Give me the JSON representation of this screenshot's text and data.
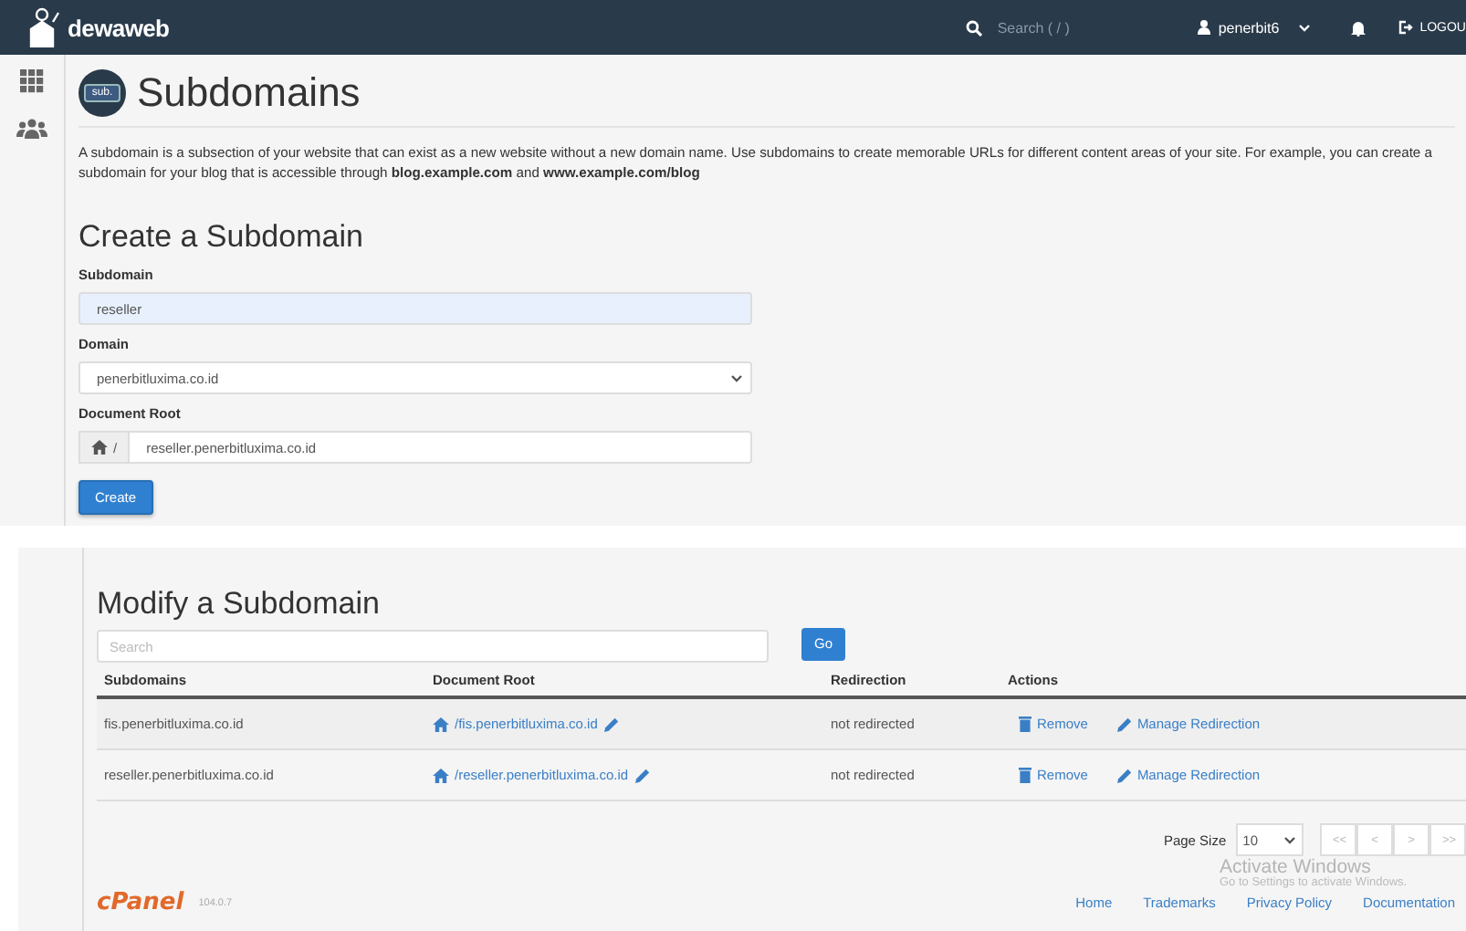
{
  "top_bar": {
    "brand": "dewaweb",
    "search": {
      "placeholder": "Search ( / )"
    },
    "user": "penerbit6",
    "logout": "LOGOU"
  },
  "page": {
    "title": "Subdomains",
    "icon_text": "sub.",
    "description": "A subdomain is a subsection of your website that can exist as a new website without a new domain name. Use subdomains to create memorable URLs for different content areas of your site. For example, you can create a subdomain for your blog that is accessible through **blog.example.com** and **www.example.com/blog**"
  },
  "create": {
    "heading": "Create a Subdomain",
    "fields": [
      {
        "label": "Subdomain",
        "kind": "text",
        "value": "reseller",
        "highlighted": true
      },
      {
        "label": "Domain",
        "kind": "select",
        "value": "penerbitluxima.co.id",
        "highlighted": false
      },
      {
        "label": "Document Root",
        "kind": "addon",
        "addon": "/",
        "value": "reseller.penerbitluxima.co.id",
        "highlighted": false
      }
    ],
    "button": "Create"
  },
  "modify": {
    "heading": "Modify a Subdomain",
    "search": {
      "placeholder": "Search"
    },
    "go": "Go",
    "columns": [
      "Subdomains",
      "Document Root",
      "Redirection",
      "Actions"
    ],
    "rows": [
      {
        "subdomain": "fis.penerbitluxima.co.id",
        "document_root": "/fis.penerbitluxima.co.id",
        "redirection": "not redirected",
        "actions": [
          "Remove",
          "Manage Redirection"
        ]
      },
      {
        "subdomain": "reseller.penerbitluxima.co.id",
        "document_root": "/reseller.penerbitluxima.co.id",
        "redirection": "not redirected",
        "actions": [
          "Remove",
          "Manage Redirection"
        ]
      }
    ],
    "pagination": {
      "label": "Page Size",
      "page_size": "10",
      "buttons": [
        {
          "label": "<<",
          "disabled": true
        },
        {
          "label": "<",
          "disabled": true
        },
        {
          "label": ">",
          "disabled": true
        },
        {
          "label": ">>",
          "disabled": true
        }
      ]
    }
  },
  "footer": {
    "logo": "cPanel",
    "version": "104.0.7",
    "links": [
      "Home",
      "Trademarks",
      "Privacy Policy",
      "Documentation"
    ]
  },
  "os_overlay": {
    "title": "Activate Windows",
    "subtitle": "Go to Settings to activate Windows."
  }
}
